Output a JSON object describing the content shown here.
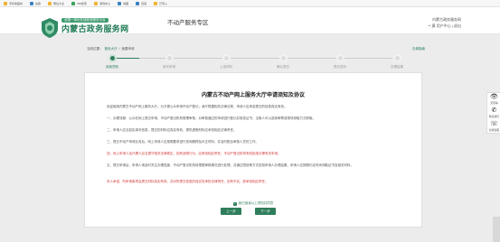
{
  "bookmarks": [
    {
      "label": "手机收藏夹",
      "color": "#f2b233"
    },
    {
      "label": "谷歌",
      "color": "#3b82c4"
    },
    {
      "label": "网址大全",
      "color": "#f2b233"
    },
    {
      "label": "360搜索",
      "color": "#3aa25b"
    },
    {
      "label": "游戏中心",
      "color": "#f2b233"
    },
    {
      "label": "地图",
      "color": "#3b82c4"
    },
    {
      "label": "百度",
      "color": "#3b82c4"
    },
    {
      "label": "已导入",
      "color": "#f2b233"
    }
  ],
  "header": {
    "logo_top": "全国一体化在线政务服务平台",
    "logo_main": "内蒙古政务服务网",
    "site_title": "不动产服务专区",
    "user_line1": "内蒙古政务服务网",
    "user_line2": "**,黄 用户中心 | 退出"
  },
  "breadcrumb": {
    "home": "当前位置：",
    "level1": "首页大厅",
    "sep": "/",
    "level2": "我要申请"
  },
  "guide_link": "办事指南",
  "steps": [
    {
      "label": "阅读须知",
      "active": true
    },
    {
      "label": "填写申请",
      "active": false
    },
    {
      "label": "上传材料",
      "active": false
    },
    {
      "label": "确认提交",
      "active": false
    },
    {
      "label": "提交成功",
      "active": false
    },
    {
      "label": "办理结果",
      "active": false
    }
  ],
  "notice": {
    "title": "内蒙古不动产网上服务大厅申请须知及协议",
    "paragraphs": [
      {
        "text": "欢迎使用内蒙古不动产网上服务大厅。为方便公众申请不动产登记，我厅根据相关法律法规，申请人应承诺提交的信息真实有效。",
        "red": false
      },
      {
        "text": "一、办理流程：公众在网上提交申请，不动产登记机构受理审核，对审核通过的申请进行登记并核发证书，当事人可以选择邮寄或现场领取方式获取。",
        "red": false
      },
      {
        "text": "二、申请人应当如实填写信息，提交的材料应真实有效，提供虚假材料应承担相应法律责任。",
        "red": false
      },
      {
        "text": "三、提交不动产申请业务后，网上申请人应按照要求进行查询跟踪及补正材料，并及时配合审核人员的工作。",
        "red": false
      },
      {
        "text": "四、网上申请人及代理人应当遵守相关法律规定，如有违规行为，应承担相应责任，不动产登记机构有权拒绝办理有关申请。",
        "red": true
      },
      {
        "text": "五、提交申请后，申请人请及时关注办理进度，不动产登记机构将根据审核情况进行处理，并通过短信等方式告知申请人办理结果，申请人应按照约定时间领取证书及相关材料。",
        "red": false
      },
      {
        "text": "本人承诺，所申请事项及提交材料真实有效，并对所提交信息的真实性承担法律责任，如有不实，愿承担相应责任。",
        "red": true
      }
    ],
    "agree_label": "我已阅读以上须知并同意"
  },
  "buttons": {
    "prev": "上一步",
    "next": "下一步"
  },
  "side_tools": [
    {
      "icon": "eye-icon",
      "glyph": "👁",
      "label": "无障碍"
    },
    {
      "icon": "phone-icon",
      "glyph": "✆",
      "label": "联系我们"
    },
    {
      "icon": "service-icon",
      "glyph": "☏",
      "label": "智能客服"
    }
  ],
  "colors": {
    "accent": "#2f7e5b",
    "warning": "#d23c3c"
  }
}
